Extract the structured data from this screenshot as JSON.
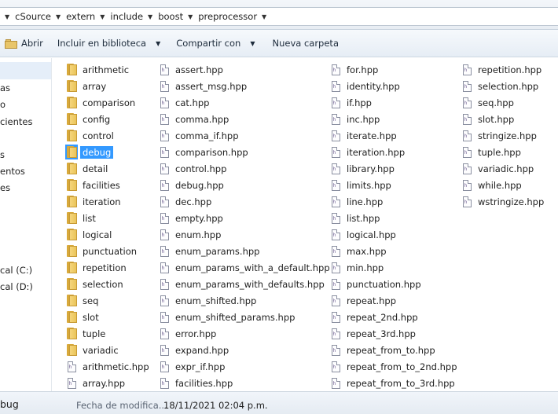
{
  "breadcrumb": [
    "cSource",
    "extern",
    "include",
    "boost",
    "preprocessor"
  ],
  "toolbar": {
    "open": "Abrir",
    "include_library": "Incluir en biblioteca",
    "share_with": "Compartir con",
    "new_folder": "Nueva carpeta"
  },
  "nav": {
    "items": [
      "as",
      "o",
      "cientes",
      "s",
      "entos",
      "es",
      "cal (C:)",
      "cal (D:)"
    ]
  },
  "files": {
    "col1": [
      {
        "name": "arithmetic",
        "type": "folder"
      },
      {
        "name": "array",
        "type": "folder"
      },
      {
        "name": "comparison",
        "type": "folder"
      },
      {
        "name": "config",
        "type": "folder"
      },
      {
        "name": "control",
        "type": "folder"
      },
      {
        "name": "debug",
        "type": "folder",
        "selected": true
      },
      {
        "name": "detail",
        "type": "folder"
      },
      {
        "name": "facilities",
        "type": "folder"
      },
      {
        "name": "iteration",
        "type": "folder"
      },
      {
        "name": "list",
        "type": "folder"
      },
      {
        "name": "logical",
        "type": "folder"
      },
      {
        "name": "punctuation",
        "type": "folder"
      },
      {
        "name": "repetition",
        "type": "folder"
      },
      {
        "name": "selection",
        "type": "folder"
      },
      {
        "name": "seq",
        "type": "folder"
      },
      {
        "name": "slot",
        "type": "folder"
      },
      {
        "name": "tuple",
        "type": "folder"
      },
      {
        "name": "variadic",
        "type": "folder"
      },
      {
        "name": "arithmetic.hpp",
        "type": "file"
      },
      {
        "name": "array.hpp",
        "type": "file"
      }
    ],
    "col2": [
      {
        "name": "assert.hpp",
        "type": "file"
      },
      {
        "name": "assert_msg.hpp",
        "type": "file"
      },
      {
        "name": "cat.hpp",
        "type": "file"
      },
      {
        "name": "comma.hpp",
        "type": "file"
      },
      {
        "name": "comma_if.hpp",
        "type": "file"
      },
      {
        "name": "comparison.hpp",
        "type": "file"
      },
      {
        "name": "control.hpp",
        "type": "file"
      },
      {
        "name": "debug.hpp",
        "type": "file"
      },
      {
        "name": "dec.hpp",
        "type": "file"
      },
      {
        "name": "empty.hpp",
        "type": "file"
      },
      {
        "name": "enum.hpp",
        "type": "file"
      },
      {
        "name": "enum_params.hpp",
        "type": "file"
      },
      {
        "name": "enum_params_with_a_default.hpp",
        "type": "file"
      },
      {
        "name": "enum_params_with_defaults.hpp",
        "type": "file"
      },
      {
        "name": "enum_shifted.hpp",
        "type": "file"
      },
      {
        "name": "enum_shifted_params.hpp",
        "type": "file"
      },
      {
        "name": "error.hpp",
        "type": "file"
      },
      {
        "name": "expand.hpp",
        "type": "file"
      },
      {
        "name": "expr_if.hpp",
        "type": "file"
      },
      {
        "name": "facilities.hpp",
        "type": "file"
      }
    ],
    "col3": [
      {
        "name": "for.hpp",
        "type": "file"
      },
      {
        "name": "identity.hpp",
        "type": "file"
      },
      {
        "name": "if.hpp",
        "type": "file"
      },
      {
        "name": "inc.hpp",
        "type": "file"
      },
      {
        "name": "iterate.hpp",
        "type": "file"
      },
      {
        "name": "iteration.hpp",
        "type": "file"
      },
      {
        "name": "library.hpp",
        "type": "file"
      },
      {
        "name": "limits.hpp",
        "type": "file"
      },
      {
        "name": "line.hpp",
        "type": "file"
      },
      {
        "name": "list.hpp",
        "type": "file"
      },
      {
        "name": "logical.hpp",
        "type": "file"
      },
      {
        "name": "max.hpp",
        "type": "file"
      },
      {
        "name": "min.hpp",
        "type": "file"
      },
      {
        "name": "punctuation.hpp",
        "type": "file"
      },
      {
        "name": "repeat.hpp",
        "type": "file"
      },
      {
        "name": "repeat_2nd.hpp",
        "type": "file"
      },
      {
        "name": "repeat_3rd.hpp",
        "type": "file"
      },
      {
        "name": "repeat_from_to.hpp",
        "type": "file"
      },
      {
        "name": "repeat_from_to_2nd.hpp",
        "type": "file"
      },
      {
        "name": "repeat_from_to_3rd.hpp",
        "type": "file"
      }
    ],
    "col4": [
      {
        "name": "repetition.hpp",
        "type": "file"
      },
      {
        "name": "selection.hpp",
        "type": "file"
      },
      {
        "name": "seq.hpp",
        "type": "file"
      },
      {
        "name": "slot.hpp",
        "type": "file"
      },
      {
        "name": "stringize.hpp",
        "type": "file"
      },
      {
        "name": "tuple.hpp",
        "type": "file"
      },
      {
        "name": "variadic.hpp",
        "type": "file"
      },
      {
        "name": "while.hpp",
        "type": "file"
      },
      {
        "name": "wstringize.hpp",
        "type": "file"
      }
    ]
  },
  "status": {
    "name": "bug",
    "modified_label": "Fecha de modifica...",
    "modified_value": "18/11/2021 02:04 p.m."
  },
  "colors": {
    "selection": "#3399ff",
    "folder": "#eac45a"
  }
}
